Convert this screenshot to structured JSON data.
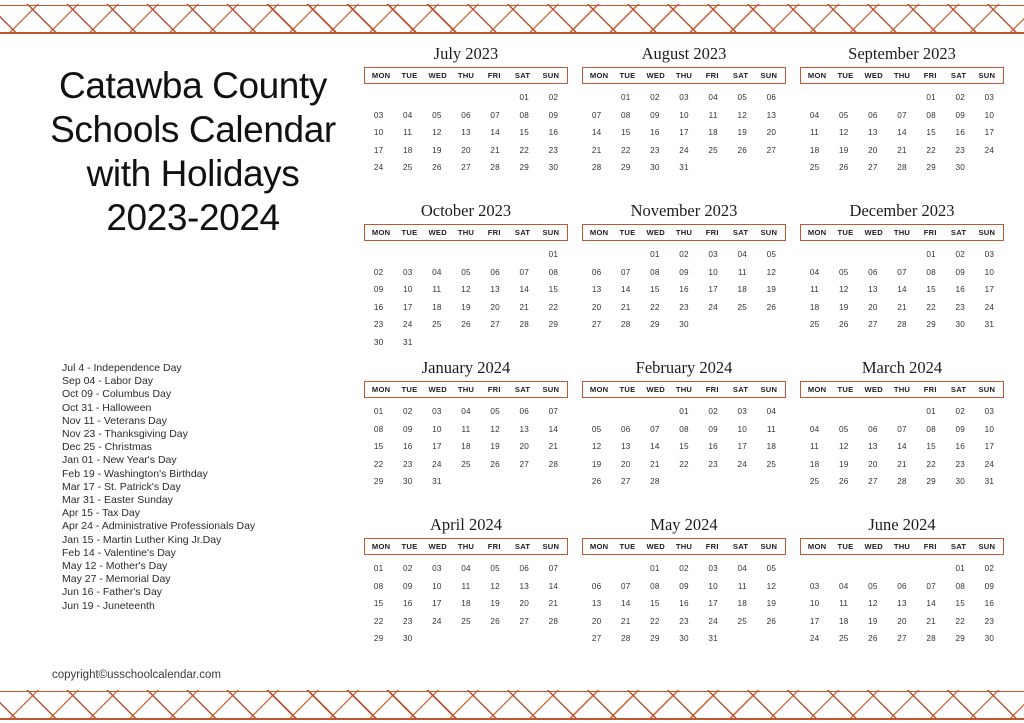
{
  "header": {
    "title_lines": [
      "Catawba County",
      "Schools Calendar",
      "with Holidays",
      "2023-2024"
    ]
  },
  "weekday_labels": [
    "MON",
    "TUE",
    "WED",
    "THU",
    "FRI",
    "SAT",
    "SUN"
  ],
  "colors": {
    "accent": "#bb5a33",
    "lattice_dark": "#b5431f",
    "lattice_light": "#c96a3c",
    "text": "#1a1a1a",
    "day_text": "#333333",
    "background": "#ffffff"
  },
  "months": [
    {
      "name": "July 2023",
      "lead_blanks": 5,
      "days": [
        "01",
        "02",
        "03",
        "04",
        "05",
        "06",
        "07",
        "08",
        "09",
        "10",
        "11",
        "12",
        "13",
        "14",
        "15",
        "16",
        "17",
        "18",
        "19",
        "20",
        "21",
        "22",
        "23",
        "24",
        "25",
        "26",
        "27",
        "28",
        "29",
        "30"
      ]
    },
    {
      "name": "August 2023",
      "lead_blanks": 1,
      "days": [
        "01",
        "02",
        "03",
        "04",
        "05",
        "06",
        "07",
        "08",
        "09",
        "10",
        "11",
        "12",
        "13",
        "14",
        "15",
        "16",
        "17",
        "18",
        "19",
        "20",
        "21",
        "22",
        "23",
        "24",
        "25",
        "26",
        "27",
        "28",
        "29",
        "30",
        "31"
      ]
    },
    {
      "name": "September 2023",
      "lead_blanks": 4,
      "days": [
        "01",
        "02",
        "03",
        "04",
        "05",
        "06",
        "07",
        "08",
        "09",
        "10",
        "11",
        "12",
        "13",
        "14",
        "15",
        "16",
        "17",
        "18",
        "19",
        "20",
        "21",
        "22",
        "23",
        "24",
        "25",
        "26",
        "27",
        "28",
        "29",
        "30"
      ]
    },
    {
      "name": "October 2023",
      "lead_blanks": 6,
      "days": [
        "01",
        "02",
        "03",
        "04",
        "05",
        "06",
        "07",
        "08",
        "09",
        "10",
        "11",
        "12",
        "13",
        "14",
        "15",
        "16",
        "17",
        "18",
        "19",
        "20",
        "21",
        "22",
        "23",
        "24",
        "25",
        "26",
        "27",
        "28",
        "29",
        "30",
        "31"
      ]
    },
    {
      "name": "November 2023",
      "lead_blanks": 2,
      "days": [
        "01",
        "02",
        "03",
        "04",
        "05",
        "06",
        "07",
        "08",
        "09",
        "10",
        "11",
        "12",
        "13",
        "14",
        "15",
        "16",
        "17",
        "18",
        "19",
        "20",
        "21",
        "22",
        "23",
        "24",
        "25",
        "26",
        "27",
        "28",
        "29",
        "30"
      ]
    },
    {
      "name": "December 2023",
      "lead_blanks": 4,
      "days": [
        "01",
        "02",
        "03",
        "04",
        "05",
        "06",
        "07",
        "08",
        "09",
        "10",
        "11",
        "12",
        "13",
        "14",
        "15",
        "16",
        "17",
        "18",
        "19",
        "20",
        "21",
        "22",
        "23",
        "24",
        "25",
        "26",
        "27",
        "28",
        "29",
        "30",
        "31"
      ]
    },
    {
      "name": "January 2024",
      "lead_blanks": 0,
      "days": [
        "01",
        "02",
        "03",
        "04",
        "05",
        "06",
        "07",
        "08",
        "09",
        "10",
        "11",
        "12",
        "13",
        "14",
        "15",
        "16",
        "17",
        "18",
        "19",
        "20",
        "21",
        "22",
        "23",
        "24",
        "25",
        "26",
        "27",
        "28",
        "29",
        "30",
        "31"
      ]
    },
    {
      "name": "February 2024",
      "lead_blanks": 3,
      "days": [
        "01",
        "02",
        "03",
        "04",
        "05",
        "06",
        "07",
        "08",
        "09",
        "10",
        "11",
        "12",
        "13",
        "14",
        "15",
        "16",
        "17",
        "18",
        "19",
        "20",
        "21",
        "22",
        "23",
        "24",
        "25",
        "26",
        "27",
        "28"
      ]
    },
    {
      "name": "March 2024",
      "lead_blanks": 4,
      "days": [
        "01",
        "02",
        "03",
        "04",
        "05",
        "06",
        "07",
        "08",
        "09",
        "10",
        "11",
        "12",
        "13",
        "14",
        "15",
        "16",
        "17",
        "18",
        "19",
        "20",
        "21",
        "22",
        "23",
        "24",
        "25",
        "26",
        "27",
        "28",
        "29",
        "30",
        "31"
      ]
    },
    {
      "name": "April 2024",
      "lead_blanks": 0,
      "days": [
        "01",
        "02",
        "03",
        "04",
        "05",
        "06",
        "07",
        "08",
        "09",
        "10",
        "11",
        "12",
        "13",
        "14",
        "15",
        "16",
        "17",
        "18",
        "19",
        "20",
        "21",
        "22",
        "23",
        "24",
        "25",
        "26",
        "27",
        "28",
        "29",
        "30"
      ]
    },
    {
      "name": "May 2024",
      "lead_blanks": 2,
      "days": [
        "01",
        "02",
        "03",
        "04",
        "05",
        "06",
        "07",
        "08",
        "09",
        "10",
        "11",
        "12",
        "13",
        "14",
        "15",
        "16",
        "17",
        "18",
        "19",
        "20",
        "21",
        "22",
        "23",
        "24",
        "25",
        "26",
        "27",
        "28",
        "29",
        "30",
        "31"
      ]
    },
    {
      "name": "June 2024",
      "lead_blanks": 5,
      "days": [
        "01",
        "02",
        "03",
        "04",
        "05",
        "06",
        "07",
        "08",
        "09",
        "10",
        "11",
        "12",
        "13",
        "14",
        "15",
        "16",
        "17",
        "18",
        "19",
        "20",
        "21",
        "22",
        "23",
        "24",
        "25",
        "26",
        "27",
        "28",
        "29",
        "30"
      ]
    }
  ],
  "holidays": [
    "Jul 4 - Independence Day",
    "Sep 04 - Labor Day",
    "Oct 09 - Columbus Day",
    "Oct 31 - Halloween",
    "Nov 11 - Veterans Day",
    "Nov 23 - Thanksgiving Day",
    "Dec 25 - Christmas",
    "Jan 01 - New Year's Day",
    "Feb 19 - Washington's Birthday",
    "Mar 17 - St. Patrick's Day",
    "Mar 31 - Easter Sunday",
    "Apr 15 - Tax Day",
    "Apr 24 - Administrative Professionals Day",
    "Jan 15 - Martin Luther King Jr.Day",
    "Feb 14 - Valentine's Day",
    "May 12 - Mother's Day",
    "May 27 - Memorial Day",
    "Jun 16 - Father's Day",
    "Jun 19 - Juneteenth"
  ],
  "footer": {
    "copyright": "copyright©usschoolcalendar.com"
  }
}
